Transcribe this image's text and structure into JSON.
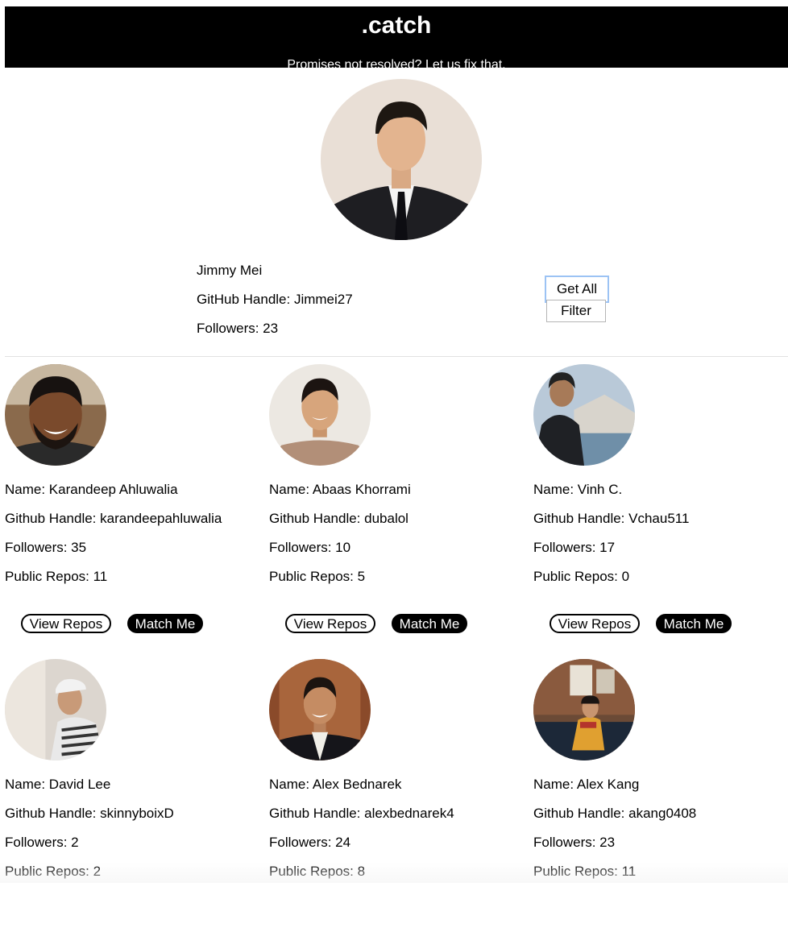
{
  "header": {
    "title": ".catch",
    "tagline": "Promises not resolved? Let us fix that."
  },
  "user": {
    "name": "Jimmy Mei",
    "handle_line": "GitHub Handle: Jimmei27",
    "followers_line": "Followers: 23"
  },
  "actions": {
    "get_all": "Get All",
    "filter": "Filter"
  },
  "cards": [
    {
      "name_line": "Name: Karandeep Ahluwalia",
      "handle_line": "Github Handle: karandeepahluwalia",
      "followers_line": "Followers: 35",
      "repos_line": "Public Repos: 11",
      "view_label": "View Repos",
      "match_label": "Match Me"
    },
    {
      "name_line": "Name: Abaas Khorrami",
      "handle_line": "Github Handle: dubalol",
      "followers_line": "Followers: 10",
      "repos_line": "Public Repos: 5",
      "view_label": "View Repos",
      "match_label": "Match Me"
    },
    {
      "name_line": "Name: Vinh C.",
      "handle_line": "Github Handle: Vchau511",
      "followers_line": "Followers: 17",
      "repos_line": "Public Repos: 0",
      "view_label": "View Repos",
      "match_label": "Match Me"
    },
    {
      "name_line": "Name: David Lee",
      "handle_line": "Github Handle: skinnyboixD",
      "followers_line": "Followers: 2",
      "repos_line": "Public Repos: 2"
    },
    {
      "name_line": "Name: Alex Bednarek",
      "handle_line": "Github Handle: alexbednarek4",
      "followers_line": "Followers: 24",
      "repos_line": "Public Repos: 8"
    },
    {
      "name_line": "Name: Alex Kang",
      "handle_line": "Github Handle: akang0408",
      "followers_line": "Followers: 23",
      "repos_line": "Public Repos: 11"
    }
  ]
}
